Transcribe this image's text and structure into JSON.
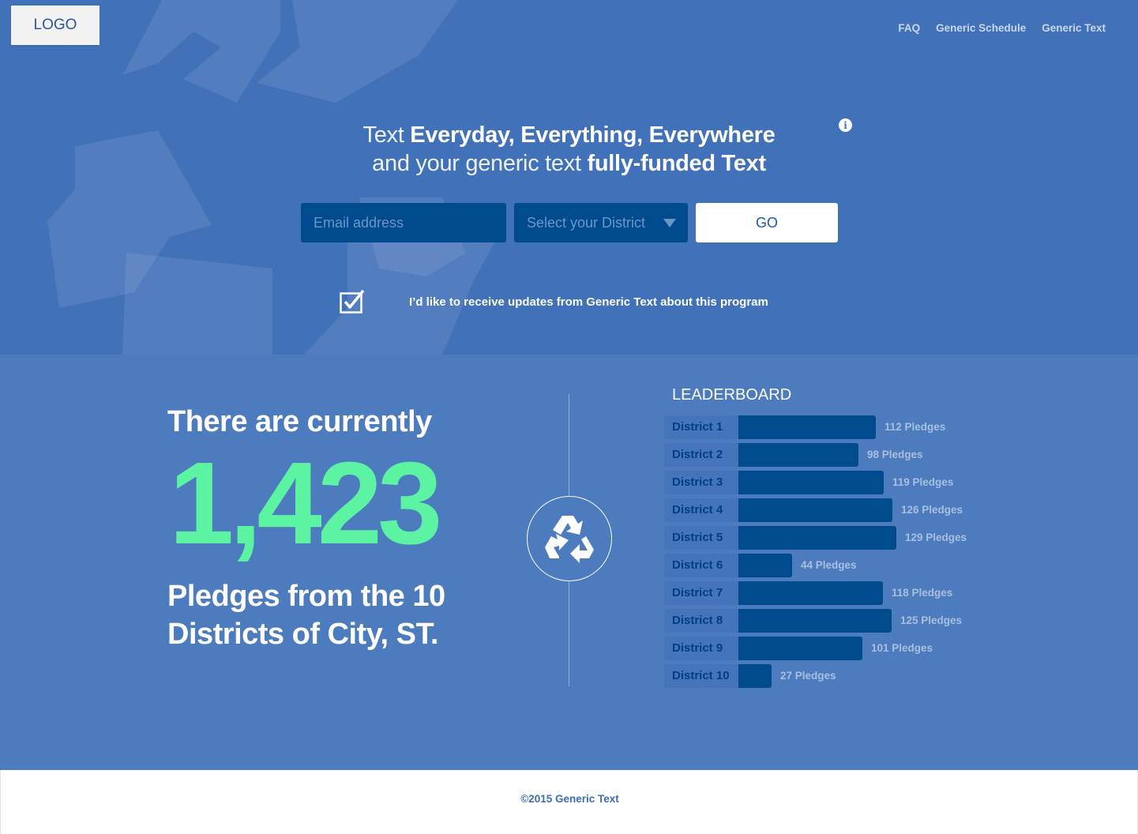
{
  "logo": {
    "text": "LOGO"
  },
  "nav": [
    {
      "label": "FAQ"
    },
    {
      "label": "Generic Schedule"
    },
    {
      "label": "Generic Text"
    }
  ],
  "hero": {
    "line1_thin": "Text",
    "line1_bold": "Everyday, Everything, Everywhere",
    "line2_thin": "and your generic text",
    "line2_bold": "fully-funded Text"
  },
  "form": {
    "email_placeholder": "Email address",
    "district_placeholder": "Select your District",
    "go_label": "GO",
    "updates_checked": true,
    "updates_label": "I’d like to receive updates from Generic Text about this program"
  },
  "stats": {
    "line1": "There are currently",
    "count": "1,423",
    "line3": "Pledges from the 10 Districts of City, ST."
  },
  "leaderboard": {
    "title": "LEADERBOARD",
    "items": [
      {
        "district": "District 1",
        "pledges": 112,
        "label": "112 Pledges"
      },
      {
        "district": "District 2",
        "pledges": 98,
        "label": "98 Pledges"
      },
      {
        "district": "District 3",
        "pledges": 119,
        "label": "119 Pledges"
      },
      {
        "district": "District 4",
        "pledges": 126,
        "label": "126 Pledges"
      },
      {
        "district": "District 5",
        "pledges": 129,
        "label": "129 Pledges"
      },
      {
        "district": "District 6",
        "pledges": 44,
        "label": "44 Pledges"
      },
      {
        "district": "District 7",
        "pledges": 118,
        "label": "118 Pledges"
      },
      {
        "district": "District 8",
        "pledges": 125,
        "label": "125 Pledges"
      },
      {
        "district": "District 9",
        "pledges": 101,
        "label": "101 Pledges"
      },
      {
        "district": "District 10",
        "pledges": 27,
        "label": "27 Pledges"
      }
    ]
  },
  "icons": {
    "info": "info-icon",
    "checkbox": "checkbox-checked-icon",
    "recycle": "recycle-icon",
    "caret": "caret-down-icon"
  },
  "colors": {
    "hero_bg": "#4171b8",
    "stats_bg": "#4c7bbe",
    "accent_green": "#5cf3a2",
    "bar": "#004b8e"
  },
  "footer": {
    "copyright": "©2015 Generic Text"
  }
}
